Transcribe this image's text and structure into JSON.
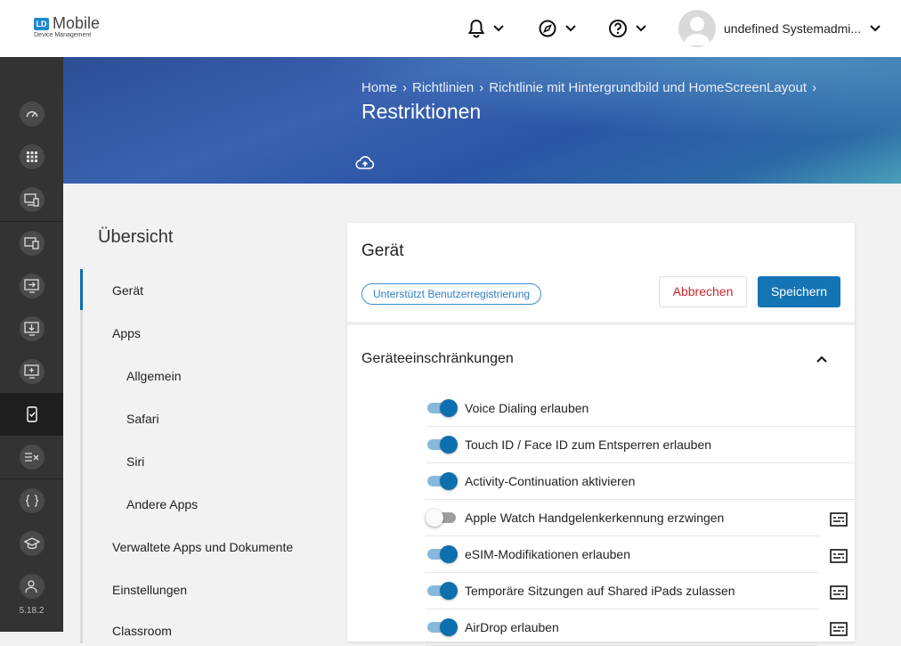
{
  "header": {
    "logo_mark": "LD",
    "logo_title": "Mobile",
    "logo_subtitle": "Device Management",
    "user_name": "undefined Systemadmi...",
    "icons": [
      "bell-icon",
      "compass-icon",
      "help-icon",
      "chevron-down-icon"
    ]
  },
  "sidebar": {
    "items": [
      "dashboard-icon",
      "apps-grid-icon",
      "device-star-icon",
      "devices-icon",
      "screen-arrow-icon",
      "download-icon",
      "monitor-plus-icon",
      "phone-check-icon",
      "list-x-icon",
      "braces-icon",
      "school-icon",
      "user-group-icon"
    ],
    "version": "5.18.2"
  },
  "banner": {
    "breadcrumb": [
      "Home",
      "Richtlinien",
      "Richtlinie mit Hintergrundbild und HomeScreenLayout"
    ],
    "title": "Restriktionen"
  },
  "overview": {
    "title": "Übersicht",
    "items": [
      "Gerät",
      "Apps",
      "Allgemein",
      "Safari",
      "Siri",
      "Andere Apps",
      "Verwaltete Apps und Dokumente",
      "Einstellungen",
      "Classroom"
    ]
  },
  "card": {
    "title": "Gerät",
    "chip": "Unterstützt Benutzerregistrierung",
    "cancel_label": "Abbrechen",
    "save_label": "Speichern",
    "section_title": "Geräteeinschränkungen",
    "rows": [
      {
        "label": "Voice Dialing erlauben",
        "on": true,
        "info": false
      },
      {
        "label": "Touch ID / Face ID zum Entsperren erlauben",
        "on": true,
        "info": false
      },
      {
        "label": "Activity-Continuation aktivieren",
        "on": true,
        "info": false
      },
      {
        "label": "Apple Watch Handgelenkerkennung erzwingen",
        "on": false,
        "info": true
      },
      {
        "label": "eSIM-Modifikationen erlauben",
        "on": true,
        "info": true
      },
      {
        "label": "Temporäre Sitzungen auf Shared iPads zulassen",
        "on": true,
        "info": true
      },
      {
        "label": "AirDrop erlauben",
        "on": true,
        "info": true
      }
    ]
  },
  "colors": {
    "accent": "#0e6fae",
    "danger": "#c8262b",
    "rail": "#333333"
  }
}
